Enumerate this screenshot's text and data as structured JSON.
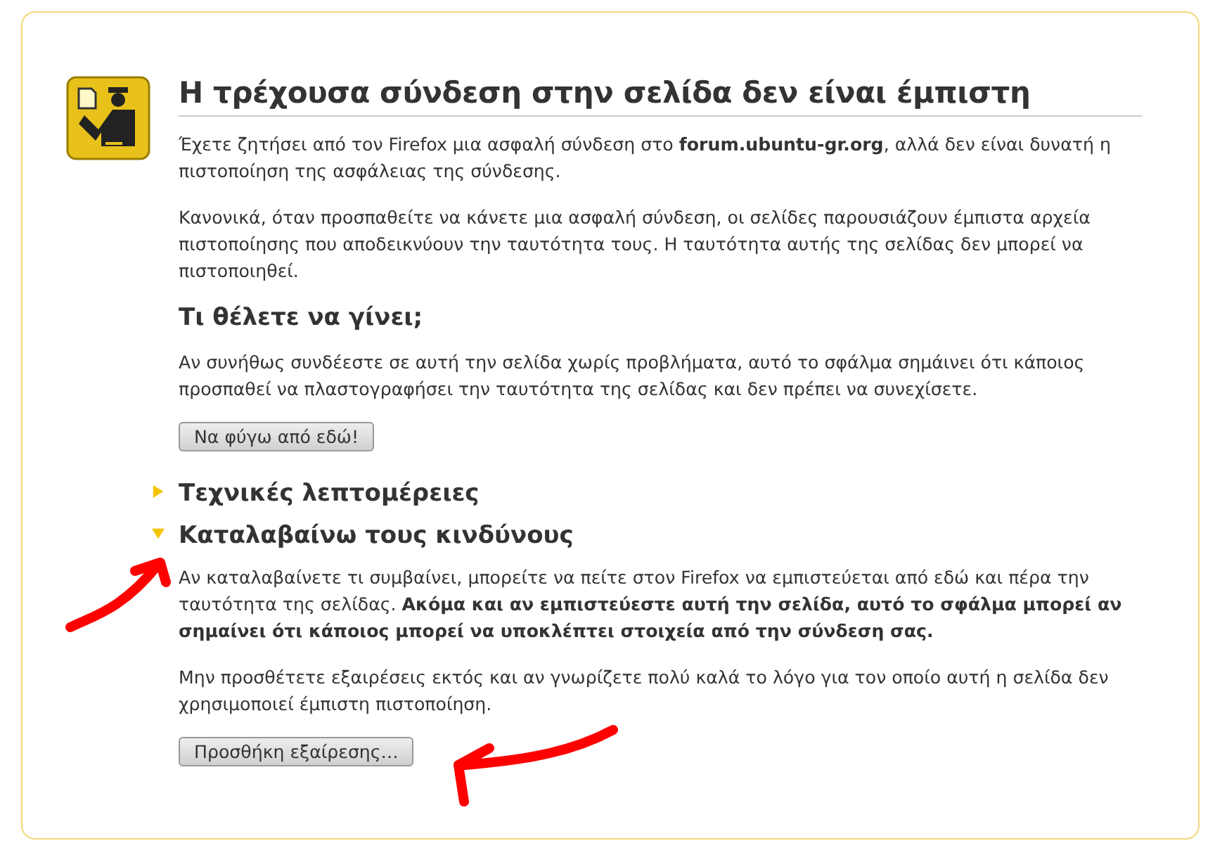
{
  "title": "Η τρέχουσα σύνδεση στην σελίδα δεν είναι έμπιστη",
  "paragraphs": [
    "Έχετε ζητήσει από τον Firefox μια ασφαλή σύνδεση στο **forum.ubuntu-gr.org**, αλλά δεν είναι δυνατή η πιστοποίηση της ασφάλειας της σύνδεσης.",
    "Κανονικά, όταν προσπαθείτε να κάνετε μια ασφαλή σύνδεση, οι σελίδες παρουσιάζουν έμπιστα αρχεία πιστοποίησης που αποδεικνύουν την ταυτότητα τους. Η ταυτότητα αυτής της σελίδας δεν μπορεί να πιστοποιηθεί."
  ],
  "question": {
    "heading": "Τι θέλετε να γίνει;",
    "text": "Αν συνήθως συνδέεστε σε αυτή την σελίδα χωρίς προβλήματα, αυτό το σφάλμα σημάινει ότι κάποιος προσπαθεί να πλαστογραφήσει την ταυτότητα της σελίδας και δεν πρέπει να συνεχίσετε.",
    "button": "Να φύγω από εδώ!"
  },
  "sections": [
    {
      "heading": "Τεχνικές λεπτομέρειες",
      "expanded": false
    },
    {
      "heading": "Καταλαβαίνω τους κινδύνους",
      "expanded": true,
      "paragraphs": [
        "Αν καταλαβαίνετε τι συμβαίνει, μπορείτε να πείτε στον Firefox να εμπιστεύεται από εδώ και πέρα την ταυτότητα της σελίδας. **Ακόμα και αν εμπιστεύεστε αυτή την σελίδα, αυτό το σφάλμα μπορεί αν σημαίνει ότι κάποιος μπορεί να υποκλέπτει στοιχεία από την σύνδεση σας.**",
        "Μην προσθέτετε εξαιρέσεις εκτός και αν γνωρίζετε πολύ καλά το λόγο για τον οποίο αυτή η σελίδα δεν χρησιμοποιεί έμπιστη πιστοποίηση."
      ],
      "button": "Προσθήκη εξαίρεσης…"
    }
  ]
}
